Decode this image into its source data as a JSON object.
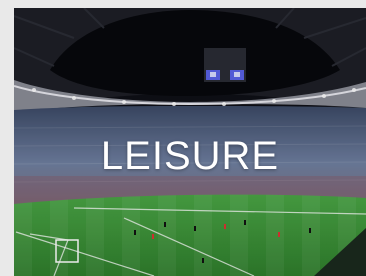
{
  "card": {
    "title": "LEISURE",
    "image": "stadium-photo",
    "colors": {
      "pitch": "#3f9a3b",
      "stands": "#5a6a86",
      "roof": "#1b1c22",
      "title": "#ffffff"
    }
  }
}
